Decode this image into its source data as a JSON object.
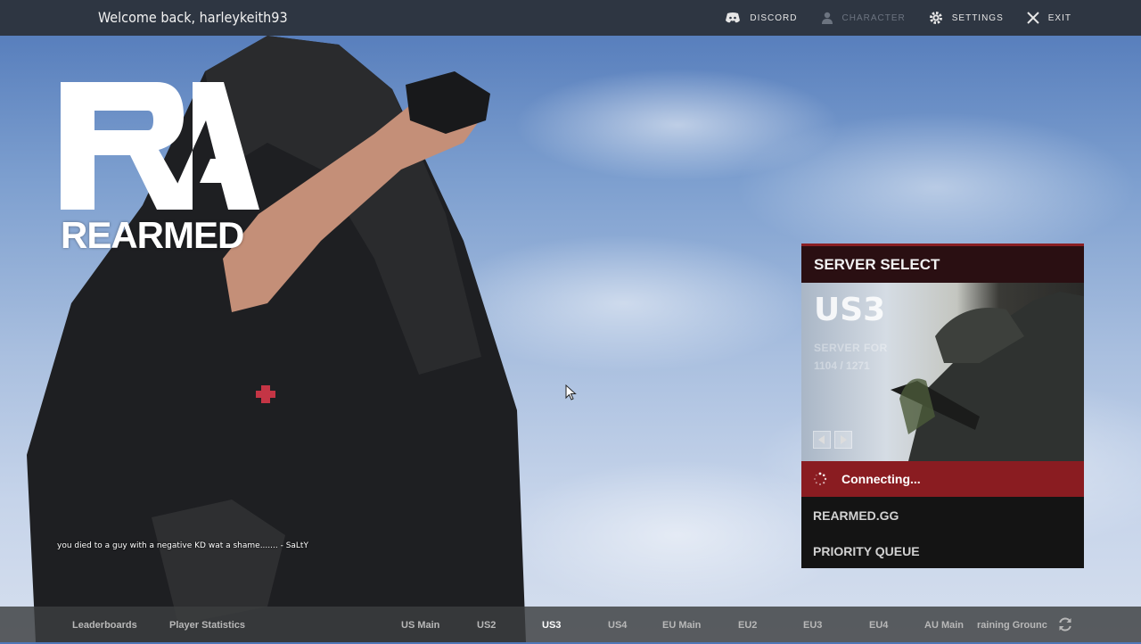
{
  "topbar": {
    "welcome": "Welcome back, harleykeith93",
    "nav": [
      {
        "label": "DISCORD",
        "icon": "discord-icon",
        "enabled": true
      },
      {
        "label": "CHARACTER",
        "icon": "user-icon",
        "enabled": false
      },
      {
        "label": "SETTINGS",
        "icon": "gear-icon",
        "enabled": true
      },
      {
        "label": "EXIT",
        "icon": "close-icon",
        "enabled": true
      }
    ]
  },
  "logo": {
    "letters": "RA",
    "word": "REARMED"
  },
  "death_message": "you died to a guy with a negative KD wat a shame....... - SaLtY",
  "server_panel": {
    "title": "SERVER SELECT",
    "server_name": "US3",
    "status": "SERVER FOR",
    "population": "1104 / 1271",
    "connecting": "Connecting...",
    "links": [
      "REARMED.GG",
      "PRIORITY QUEUE"
    ]
  },
  "bottombar": {
    "left": [
      "Leaderboards",
      "Player Statistics"
    ],
    "servers": [
      "US Main",
      "US2",
      "US3",
      "US4",
      "EU Main",
      "EU2",
      "EU3",
      "EU4",
      "AU Main",
      "raining Grounc"
    ],
    "active": "US3"
  },
  "colors": {
    "accent_red": "#8a1c21",
    "panel_bg": "#141414",
    "topbar_bg": "#2e3642"
  }
}
